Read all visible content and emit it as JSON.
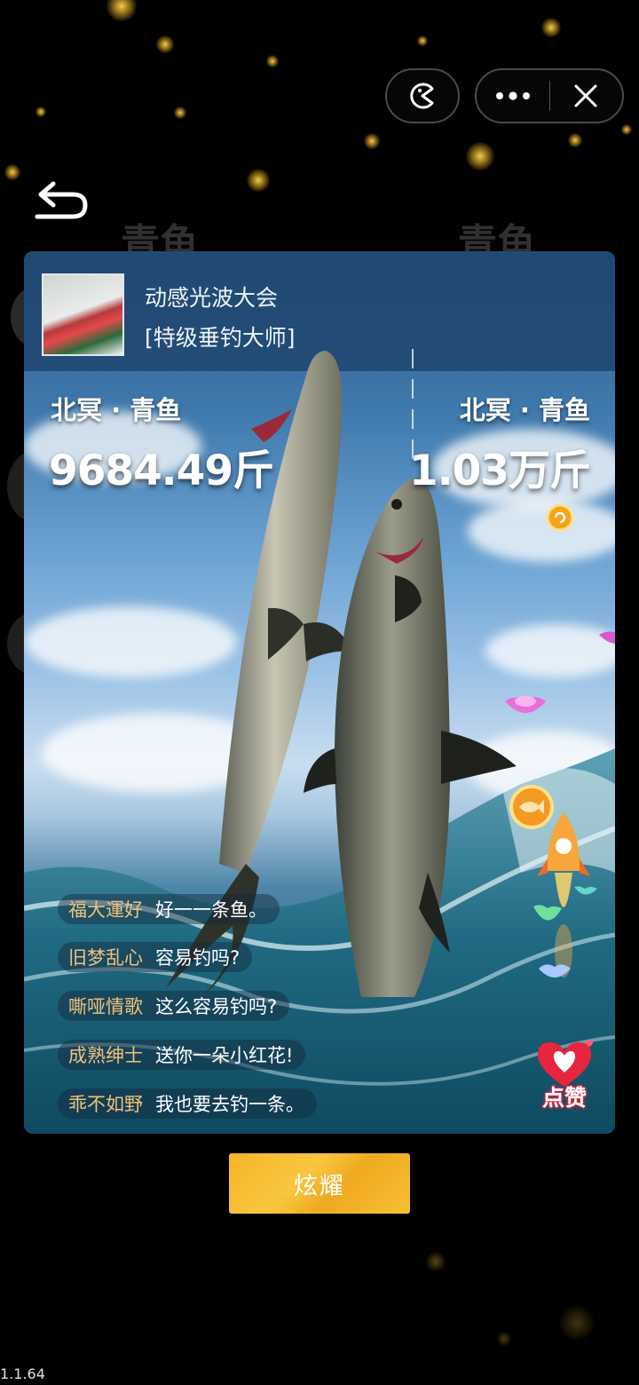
{
  "ghost_titles": [
    "青鱼",
    "青鱼"
  ],
  "player": {
    "name": "动感光波大会",
    "title": "[特级垂钓大师]"
  },
  "catches": [
    {
      "label": "北冥 · 青鱼",
      "weight": "9684.49斤"
    },
    {
      "label": "北冥 · 青鱼",
      "weight": "1.03万斤"
    }
  ],
  "chat": [
    {
      "user": "福大運好",
      "message": "好一一条鱼。"
    },
    {
      "user": "旧梦乱心",
      "message": "容易钓吗?"
    },
    {
      "user": "嘶哑情歌",
      "message": "这么容易钓吗?"
    },
    {
      "user": "成熟绅士",
      "message": "送你一朵小红花!"
    },
    {
      "user": "乖不如野",
      "message": "我也要去钓一条。"
    }
  ],
  "like_label": "点赞",
  "show_button": "炫耀",
  "version": "1.1.64",
  "icons": {
    "capsule_left": "pacman-icon",
    "capsule_more": "more-dots-icon",
    "capsule_close": "close-icon",
    "back": "back-arrow-icon"
  },
  "colors": {
    "show_button": "#f7bb30",
    "chat_user": "#f1c27a",
    "like": "#e8253f"
  }
}
